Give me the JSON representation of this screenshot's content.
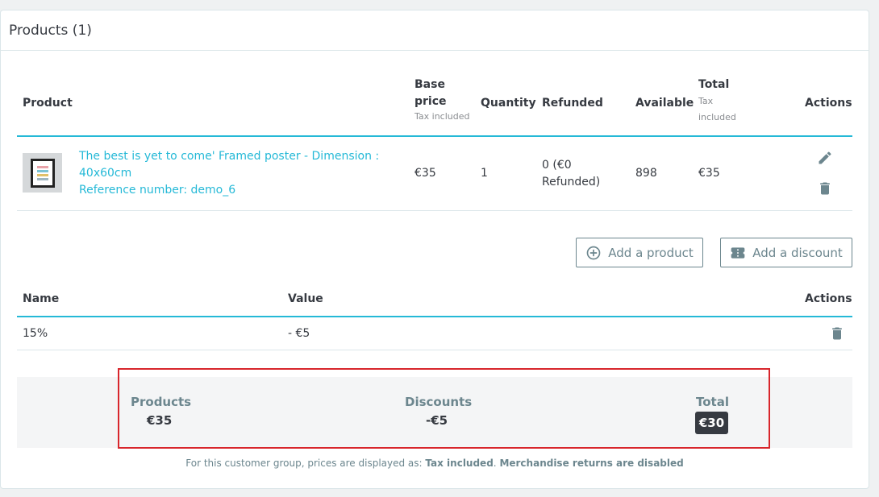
{
  "panel": {
    "title": "Products (1)"
  },
  "products_table": {
    "headers": {
      "product": "Product",
      "base_price": "Base price",
      "base_price_sub": "Tax included",
      "quantity": "Quantity",
      "refunded": "Refunded",
      "available": "Available",
      "total": "Total",
      "total_sub": "Tax included",
      "actions": "Actions"
    },
    "rows": [
      {
        "name_line1": "The best is yet to come' Framed poster - Dimension :",
        "name_line2": "40x60cm",
        "reference": "Reference number: demo_6",
        "base_price": "€35",
        "quantity": "1",
        "refunded_line1": "0 (€0",
        "refunded_line2": "Refunded)",
        "available": "898",
        "total": "€35",
        "edit_icon": "pencil-icon",
        "delete_icon": "trash-icon"
      }
    ]
  },
  "buttons": {
    "add_product": "Add a product",
    "add_product_icon": "plus-circle-icon",
    "add_discount": "Add a discount",
    "add_discount_icon": "ticket-icon"
  },
  "discounts_table": {
    "headers": {
      "name": "Name",
      "value": "Value",
      "actions": "Actions"
    },
    "rows": [
      {
        "name": "15%",
        "value": "- €5",
        "delete_icon": "trash-icon"
      }
    ]
  },
  "summary": {
    "products_label": "Products",
    "products_value": "€35",
    "discounts_label": "Discounts",
    "discounts_value": "-€5",
    "total_label": "Total",
    "total_value": "€30"
  },
  "footer": {
    "prefix": "For this customer group, prices are displayed as: ",
    "tax_mode": "Tax included",
    "separator": ". ",
    "returns": "Merchandise returns are disabled"
  },
  "colors": {
    "accent": "#25b9d7",
    "highlight_border": "#d8262c",
    "badge": "#363a41"
  }
}
